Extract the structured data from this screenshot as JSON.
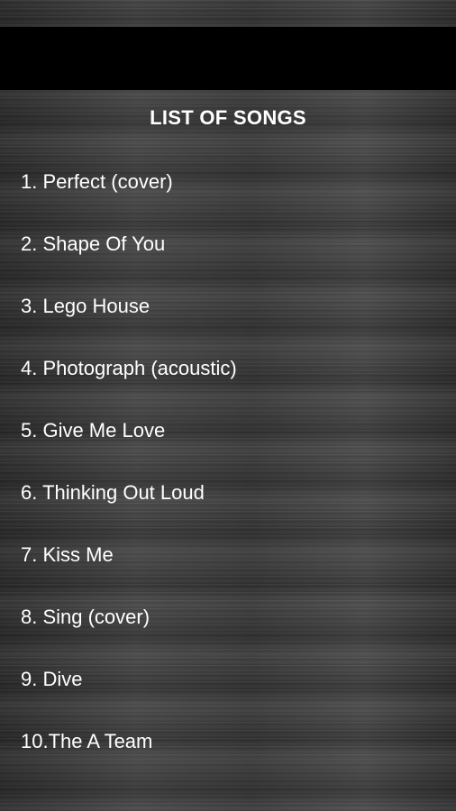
{
  "header": {
    "title": "LIST OF SONGS"
  },
  "songs": [
    {
      "label": "1. Perfect (cover)"
    },
    {
      "label": "2. Shape Of You"
    },
    {
      "label": "3. Lego House"
    },
    {
      "label": "4. Photograph (acoustic)"
    },
    {
      "label": "5. Give Me Love"
    },
    {
      "label": "6. Thinking Out Loud"
    },
    {
      "label": "7. Kiss Me"
    },
    {
      "label": "8. Sing (cover)"
    },
    {
      "label": "9. Dive"
    },
    {
      "label": "10.The A Team"
    }
  ],
  "colors": {
    "banner": "#000000",
    "text": "#ffffff",
    "background": "#3a3a3a"
  }
}
